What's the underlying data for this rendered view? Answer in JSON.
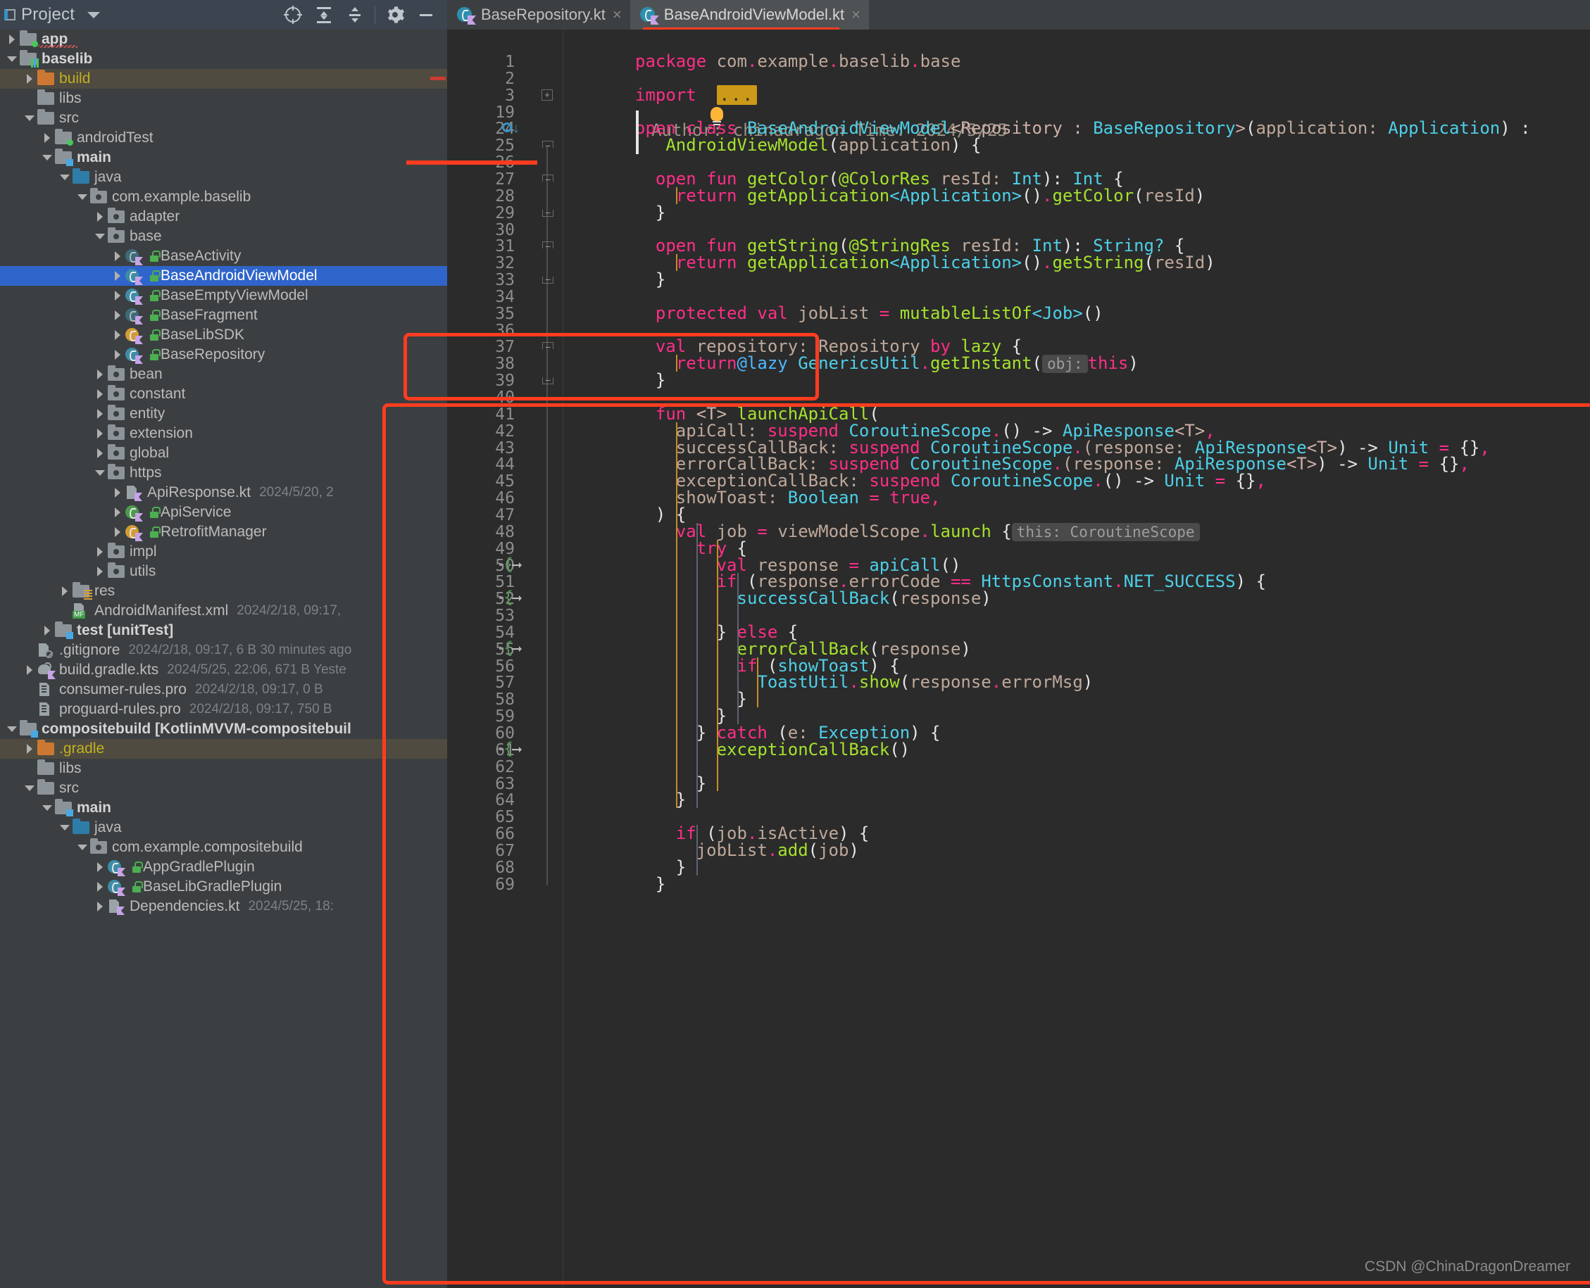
{
  "project_panel": {
    "title": "Project",
    "icons": [
      "locate-icon",
      "expand-all-icon",
      "collapse-all-icon",
      "gear-icon",
      "minimize-icon"
    ],
    "tree": [
      {
        "indent": 0,
        "arrow": "right",
        "icon": "folder-module-green",
        "label": "app",
        "bold": true,
        "meta": "",
        "squiggle": true
      },
      {
        "indent": 0,
        "arrow": "down",
        "icon": "folder-module-bars",
        "label": "baselib",
        "bold": true,
        "meta": ""
      },
      {
        "indent": 1,
        "arrow": "right",
        "icon": "folder-orange",
        "label": "build",
        "bold": false,
        "meta": "",
        "state": "highlight"
      },
      {
        "indent": 1,
        "arrow": "none",
        "icon": "folder-grey",
        "label": "libs",
        "bold": false,
        "meta": ""
      },
      {
        "indent": 1,
        "arrow": "down",
        "icon": "folder-grey",
        "label": "src",
        "bold": false,
        "meta": ""
      },
      {
        "indent": 2,
        "arrow": "right",
        "icon": "folder-test",
        "label": "androidTest",
        "bold": false,
        "meta": ""
      },
      {
        "indent": 2,
        "arrow": "down",
        "icon": "folder-module-blue",
        "label": "main",
        "bold": true,
        "meta": ""
      },
      {
        "indent": 3,
        "arrow": "down",
        "icon": "folder-blue",
        "label": "java",
        "bold": false,
        "meta": ""
      },
      {
        "indent": 4,
        "arrow": "down",
        "icon": "package-icon",
        "label": "com.example.baselib",
        "bold": false,
        "meta": ""
      },
      {
        "indent": 5,
        "arrow": "right",
        "icon": "package-icon",
        "label": "adapter",
        "bold": false,
        "meta": ""
      },
      {
        "indent": 5,
        "arrow": "down",
        "icon": "package-icon",
        "label": "base",
        "bold": false,
        "meta": ""
      },
      {
        "indent": 6,
        "arrow": "right",
        "icon": "kotlin-class-teal-dim",
        "label": "BaseActivity",
        "bold": false,
        "meta": "",
        "lock": true
      },
      {
        "indent": 6,
        "arrow": "right",
        "icon": "kotlin-class-teal",
        "label": "BaseAndroidViewModel",
        "bold": false,
        "meta": "",
        "lock": true,
        "state": "selected"
      },
      {
        "indent": 6,
        "arrow": "right",
        "icon": "kotlin-class-teal",
        "label": "BaseEmptyViewModel",
        "bold": false,
        "meta": "",
        "lock": true
      },
      {
        "indent": 6,
        "arrow": "right",
        "icon": "kotlin-class-teal-dim",
        "label": "BaseFragment",
        "bold": false,
        "meta": "",
        "lock": true
      },
      {
        "indent": 6,
        "arrow": "right",
        "icon": "kotlin-object-orange",
        "label": "BaseLibSDK",
        "bold": false,
        "meta": "",
        "lock": true
      },
      {
        "indent": 6,
        "arrow": "right",
        "icon": "kotlin-class-teal",
        "label": "BaseRepository",
        "bold": false,
        "meta": "",
        "lock": true
      },
      {
        "indent": 5,
        "arrow": "right",
        "icon": "package-icon",
        "label": "bean",
        "bold": false,
        "meta": ""
      },
      {
        "indent": 5,
        "arrow": "right",
        "icon": "package-icon",
        "label": "constant",
        "bold": false,
        "meta": ""
      },
      {
        "indent": 5,
        "arrow": "right",
        "icon": "package-icon",
        "label": "entity",
        "bold": false,
        "meta": ""
      },
      {
        "indent": 5,
        "arrow": "right",
        "icon": "package-icon",
        "label": "extension",
        "bold": false,
        "meta": ""
      },
      {
        "indent": 5,
        "arrow": "right",
        "icon": "package-icon",
        "label": "global",
        "bold": false,
        "meta": ""
      },
      {
        "indent": 5,
        "arrow": "down",
        "icon": "package-icon",
        "label": "https",
        "bold": false,
        "meta": ""
      },
      {
        "indent": 6,
        "arrow": "right",
        "icon": "kotlin-file",
        "label": "ApiResponse.kt",
        "bold": false,
        "meta": "2024/5/20, 2"
      },
      {
        "indent": 6,
        "arrow": "right",
        "icon": "kotlin-interface-green",
        "label": "ApiService",
        "bold": false,
        "meta": "",
        "lock": true
      },
      {
        "indent": 6,
        "arrow": "right",
        "icon": "kotlin-object-orange",
        "label": "RetrofitManager",
        "bold": false,
        "meta": "",
        "lock": true
      },
      {
        "indent": 5,
        "arrow": "right",
        "icon": "package-icon",
        "label": "impl",
        "bold": false,
        "meta": ""
      },
      {
        "indent": 5,
        "arrow": "right",
        "icon": "package-icon",
        "label": "utils",
        "bold": false,
        "meta": ""
      },
      {
        "indent": 3,
        "arrow": "right",
        "icon": "folder-res",
        "label": "res",
        "bold": false,
        "meta": ""
      },
      {
        "indent": 3,
        "arrow": "none",
        "icon": "manifest-file",
        "label": "AndroidManifest.xml",
        "bold": false,
        "meta": "2024/2/18, 09:17,"
      },
      {
        "indent": 2,
        "arrow": "right",
        "icon": "folder-module-blue",
        "label": "test [unitTest]",
        "bold": true,
        "meta": ""
      },
      {
        "indent": 1,
        "arrow": "none",
        "icon": "gitignore-file",
        "label": ".gitignore",
        "bold": false,
        "meta": "2024/2/18, 09:17, 6 B 30 minutes ago"
      },
      {
        "indent": 1,
        "arrow": "right",
        "icon": "gradle-kts-file",
        "label": "build.gradle.kts",
        "bold": false,
        "meta": "2024/5/25, 22:06, 671 B Yeste"
      },
      {
        "indent": 1,
        "arrow": "none",
        "icon": "pro-file",
        "label": "consumer-rules.pro",
        "bold": false,
        "meta": "2024/2/18, 09:17, 0 B"
      },
      {
        "indent": 1,
        "arrow": "none",
        "icon": "pro-file",
        "label": "proguard-rules.pro",
        "bold": false,
        "meta": "2024/2/18, 09:17, 750 B"
      },
      {
        "indent": 0,
        "arrow": "down",
        "icon": "folder-module-blue",
        "label": "compositebuild [KotlinMVVM-compositebuil",
        "bold": true,
        "meta": ""
      },
      {
        "indent": 1,
        "arrow": "right",
        "icon": "folder-orange",
        "label": ".gradle",
        "bold": false,
        "meta": "",
        "state": "highlight"
      },
      {
        "indent": 1,
        "arrow": "none",
        "icon": "folder-grey",
        "label": "libs",
        "bold": false,
        "meta": ""
      },
      {
        "indent": 1,
        "arrow": "down",
        "icon": "folder-grey",
        "label": "src",
        "bold": false,
        "meta": ""
      },
      {
        "indent": 2,
        "arrow": "down",
        "icon": "folder-module-blue",
        "label": "main",
        "bold": true,
        "meta": ""
      },
      {
        "indent": 3,
        "arrow": "down",
        "icon": "folder-blue",
        "label": "java",
        "bold": false,
        "meta": ""
      },
      {
        "indent": 4,
        "arrow": "down",
        "icon": "package-icon",
        "label": "com.example.compositebuild",
        "bold": false,
        "meta": ""
      },
      {
        "indent": 5,
        "arrow": "right",
        "icon": "kotlin-class-teal",
        "label": "AppGradlePlugin",
        "bold": false,
        "meta": "",
        "lock": true
      },
      {
        "indent": 5,
        "arrow": "right",
        "icon": "kotlin-class-teal",
        "label": "BaseLibGradlePlugin",
        "bold": false,
        "meta": "",
        "lock": true
      },
      {
        "indent": 5,
        "arrow": "right",
        "icon": "kotlin-file",
        "label": "Dependencies.kt",
        "bold": false,
        "meta": "2024/5/25, 18:"
      }
    ]
  },
  "tabs": [
    {
      "label": "BaseRepository.kt",
      "icon": "kotlin-file-icon",
      "active": false,
      "close": "×"
    },
    {
      "label": "BaseAndroidViewModel.kt",
      "icon": "kotlin-file-icon",
      "active": true,
      "close": "×"
    }
  ],
  "editor": {
    "line_numbers": [
      1,
      2,
      3,
      19,
      24,
      25,
      26,
      27,
      28,
      29,
      30,
      31,
      32,
      33,
      34,
      35,
      36,
      37,
      38,
      39,
      40,
      41,
      42,
      43,
      44,
      45,
      46,
      47,
      48,
      49,
      50,
      51,
      52,
      53,
      54,
      55,
      56,
      57,
      58,
      59,
      60,
      61,
      62,
      63,
      64,
      65,
      66,
      67,
      68,
      69
    ],
    "comment": "Author: chinadragon Time: 2024/5/25",
    "import_fold": "...",
    "inlay_obj": "obj:",
    "inlay_this": "this: CoroutineScope",
    "code_lines": [
      "package com.example.baselib.base",
      "",
      "import ...",
      "",
      "open class BaseAndroidViewModel<Repository : BaseRepository>(application: Application) :",
      "    AndroidViewModel(application) {",
      "",
      "    open fun getColor(@ColorRes resId: Int): Int {",
      "        return getApplication<Application>().getColor(resId)",
      "    }",
      "",
      "    open fun getString(@StringRes resId: Int): String? {",
      "        return getApplication<Application>().getString(resId)",
      "    }",
      "",
      "    protected val jobList = mutableListOf<Job>()",
      "",
      "    val repository: Repository by lazy {",
      "        return@lazy GenericsUtil.getInstant( obj: this)",
      "    }",
      "",
      "    fun <T> launchApiCall(",
      "        apiCall: suspend CoroutineScope.() -> ApiResponse<T>,",
      "        successCallBack: suspend CoroutineScope.(response: ApiResponse<T>) -> Unit = {},",
      "        errorCallBack: suspend CoroutineScope.(response: ApiResponse<T>) -> Unit = {},",
      "        exceptionCallBack: suspend CoroutineScope.() -> Unit = {},",
      "        showToast: Boolean = true,",
      "    ) {",
      "        val job = viewModelScope.launch { this: CoroutineScope",
      "            try {",
      "                val response = apiCall()",
      "                if (response.errorCode == HttpsConstant.NET_SUCCESS) {",
      "                    successCallBack(response)",
      "",
      "                } else {",
      "                    errorCallBack(response)",
      "                    if (showToast) {",
      "                        ToastUtil.show(response.errorMsg)",
      "                    }",
      "                }",
      "            } catch (e: Exception) {",
      "                exceptionCallBack()",
      "",
      "            }",
      "        }",
      "",
      "        if (job.isActive) {",
      "            jobList.add(job)",
      "        }",
      "    }"
    ]
  },
  "watermark": "CSDN @ChinaDragonDreamer",
  "colors": {
    "accent_red": "#ff3c1f",
    "selection_blue": "#2f65ca",
    "panel_bg": "#3c3f41",
    "editor_bg": "#2b2b2b",
    "keyword": "#ff2e88",
    "type": "#4dd0e8",
    "function": "#a5e22e",
    "plain": "#bfa89a"
  }
}
